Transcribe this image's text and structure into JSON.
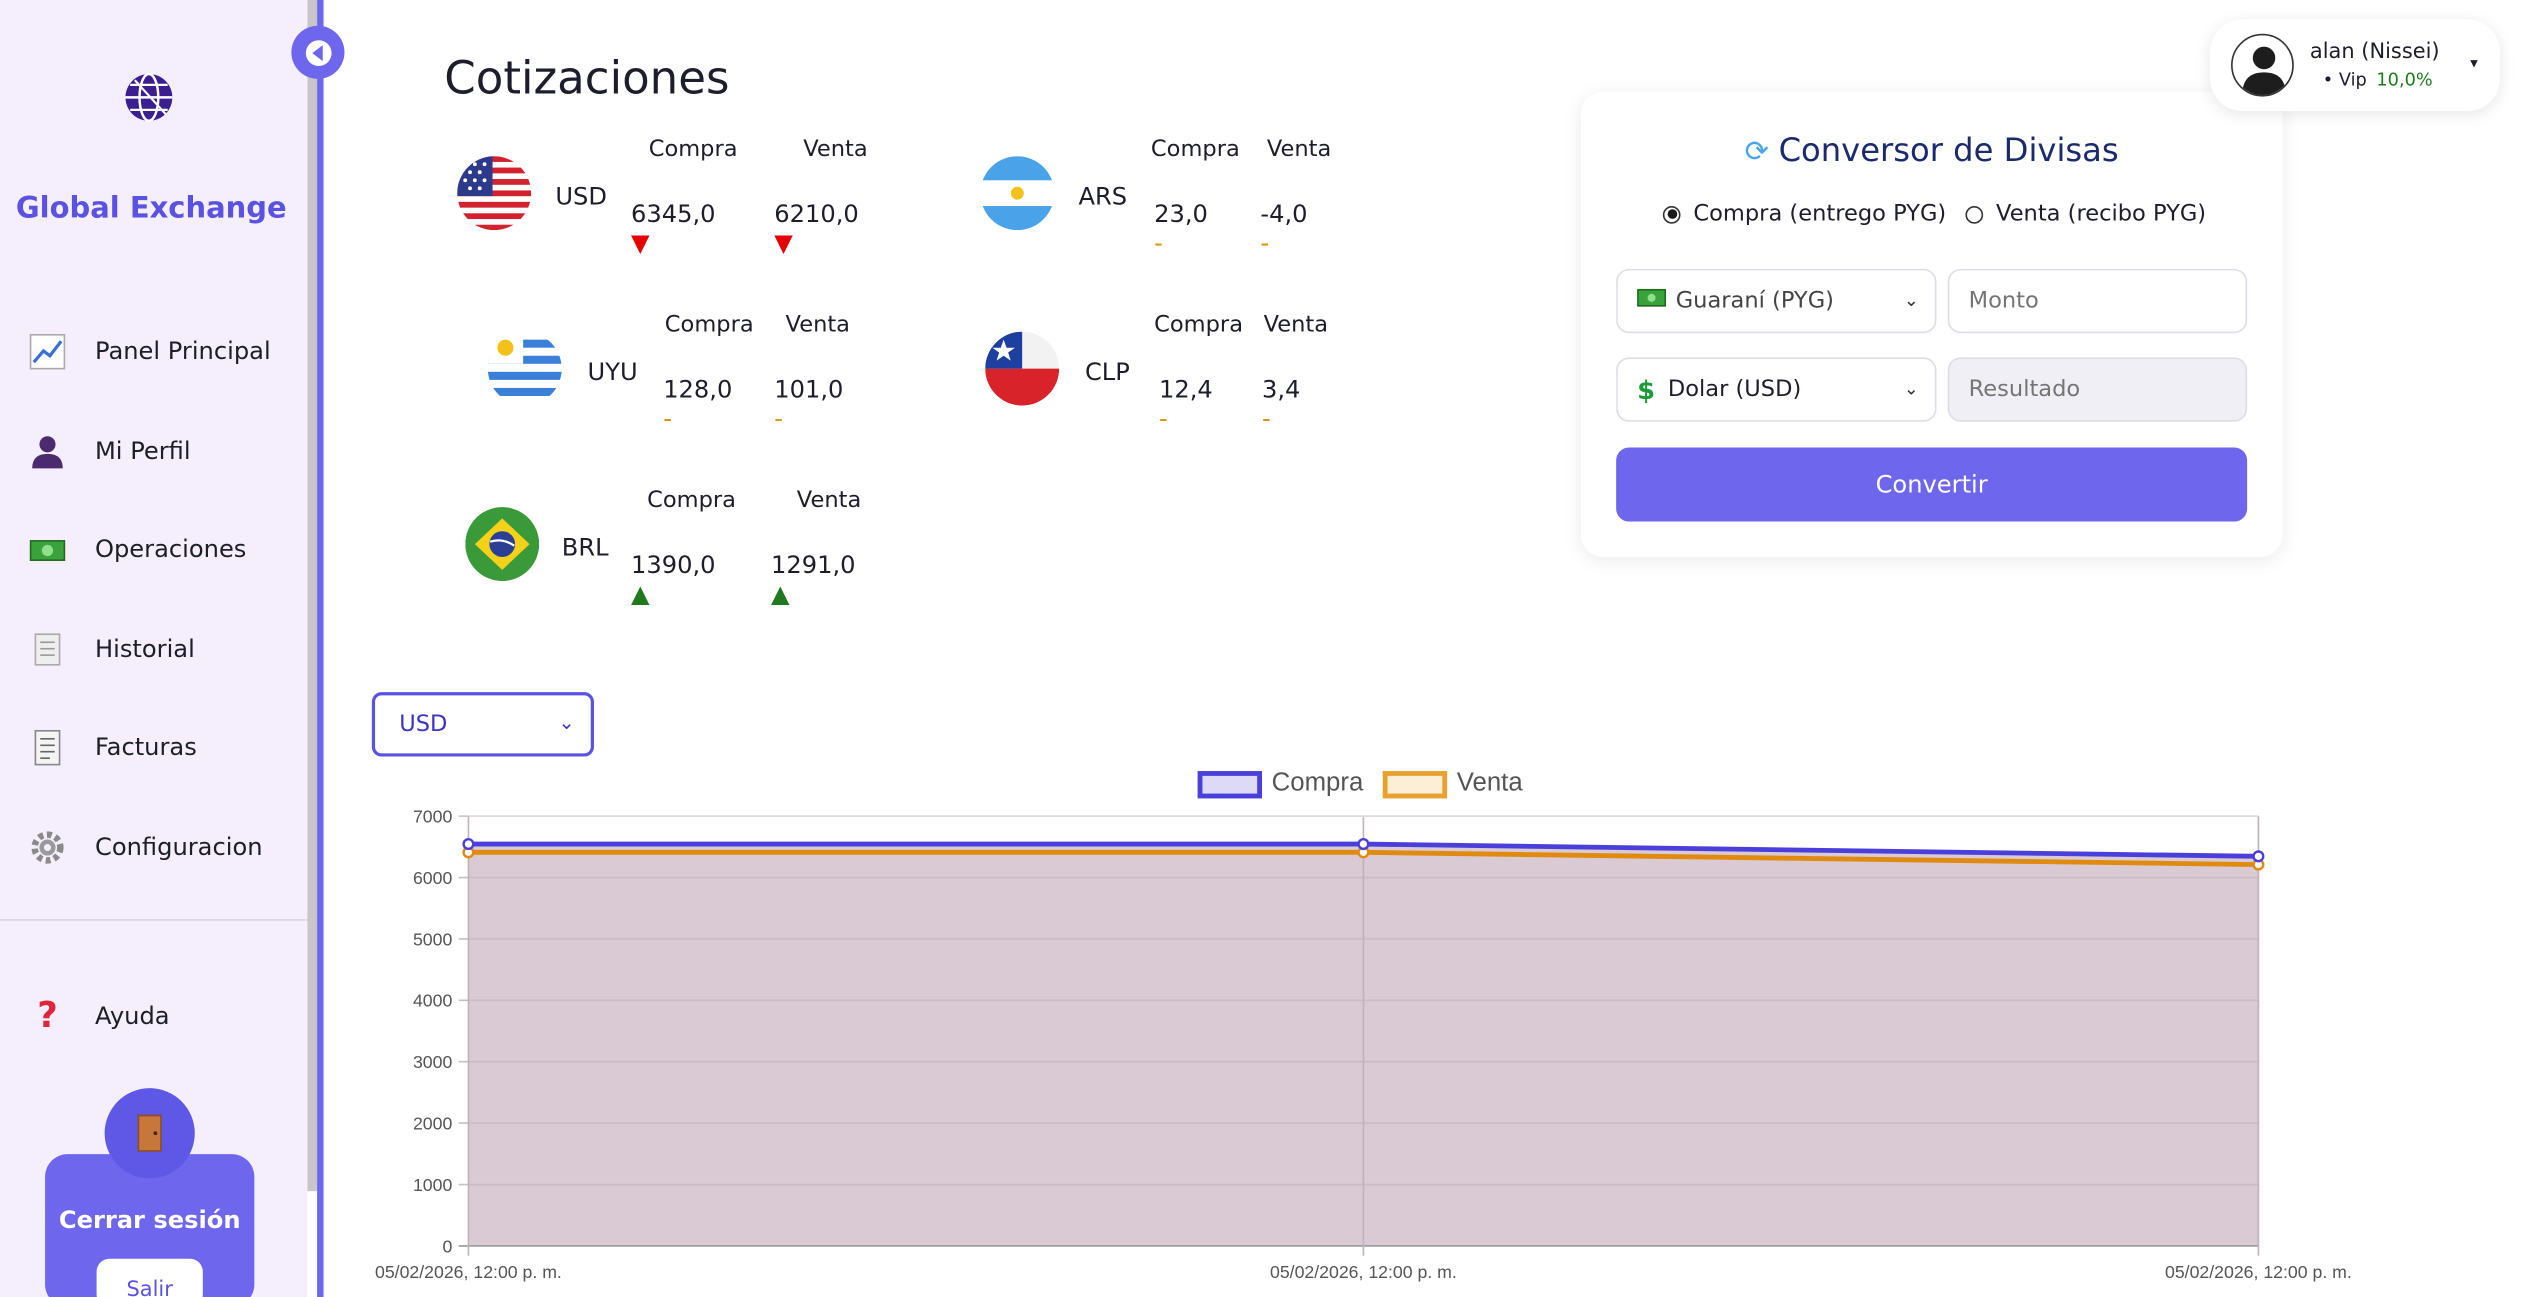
{
  "sidebar": {
    "brand": "Global Exchange",
    "items": [
      {
        "label": "Panel Principal",
        "icon": "chart-increasing-icon"
      },
      {
        "label": "Mi Perfil",
        "icon": "user-icon"
      },
      {
        "label": "Operaciones",
        "icon": "money-icon"
      },
      {
        "label": "Historial",
        "icon": "scroll-icon"
      },
      {
        "label": "Facturas",
        "icon": "receipt-icon"
      },
      {
        "label": "Configuracion",
        "icon": "gear-icon"
      }
    ],
    "help": "Ayuda",
    "logout": {
      "title": "Cerrar sesión",
      "button": "Salir"
    }
  },
  "page": {
    "title": "Cotizaciones"
  },
  "rates": {
    "buy_label": "Compra",
    "sell_label": "Venta",
    "items": [
      {
        "code": "USD",
        "buy": "6345,0",
        "sell": "6210,0",
        "buy_trend": "down",
        "sell_trend": "down"
      },
      {
        "code": "ARS",
        "buy": "23,0",
        "sell": "-4,0",
        "buy_trend": "flat",
        "sell_trend": "flat"
      },
      {
        "code": "UYU",
        "buy": "128,0",
        "sell": "101,0",
        "buy_trend": "flat",
        "sell_trend": "flat"
      },
      {
        "code": "CLP",
        "buy": "12,4",
        "sell": "3,4",
        "buy_trend": "flat",
        "sell_trend": "flat"
      },
      {
        "code": "BRL",
        "buy": "1390,0",
        "sell": "1291,0",
        "buy_trend": "up",
        "sell_trend": "up"
      }
    ]
  },
  "converter": {
    "title": "Conversor de Divisas",
    "option_buy": "Compra (entrego PYG)",
    "option_sell": "Venta (recibo PYG)",
    "selected": "buy",
    "from_currency": "Guaraní (PYG)",
    "to_currency": "Dolar (USD)",
    "amount_placeholder": "Monto",
    "result_placeholder": "Resultado",
    "button": "Convertir"
  },
  "user": {
    "name": "alan (Nissei)",
    "tier": "• Vip",
    "discount": "10,0%"
  },
  "chart_selector": {
    "selected": "USD"
  },
  "chart_data": {
    "type": "line",
    "x": [
      "05/02/2026, 12:00 p. m.",
      "05/02/2026, 12:00 p. m.",
      "05/02/2026, 12:00 p. m."
    ],
    "series": [
      {
        "name": "Compra",
        "values": [
          6545,
          6545,
          6345
        ],
        "color": "#4a3fdb"
      },
      {
        "name": "Venta",
        "values": [
          6410,
          6410,
          6210
        ],
        "color": "#e08a10"
      }
    ],
    "ylim": [
      0,
      7000
    ],
    "yticks": [
      0,
      1000,
      2000,
      3000,
      4000,
      5000,
      6000,
      7000
    ],
    "grid": true,
    "legend": "top",
    "fill_color": "#d9cad4"
  }
}
